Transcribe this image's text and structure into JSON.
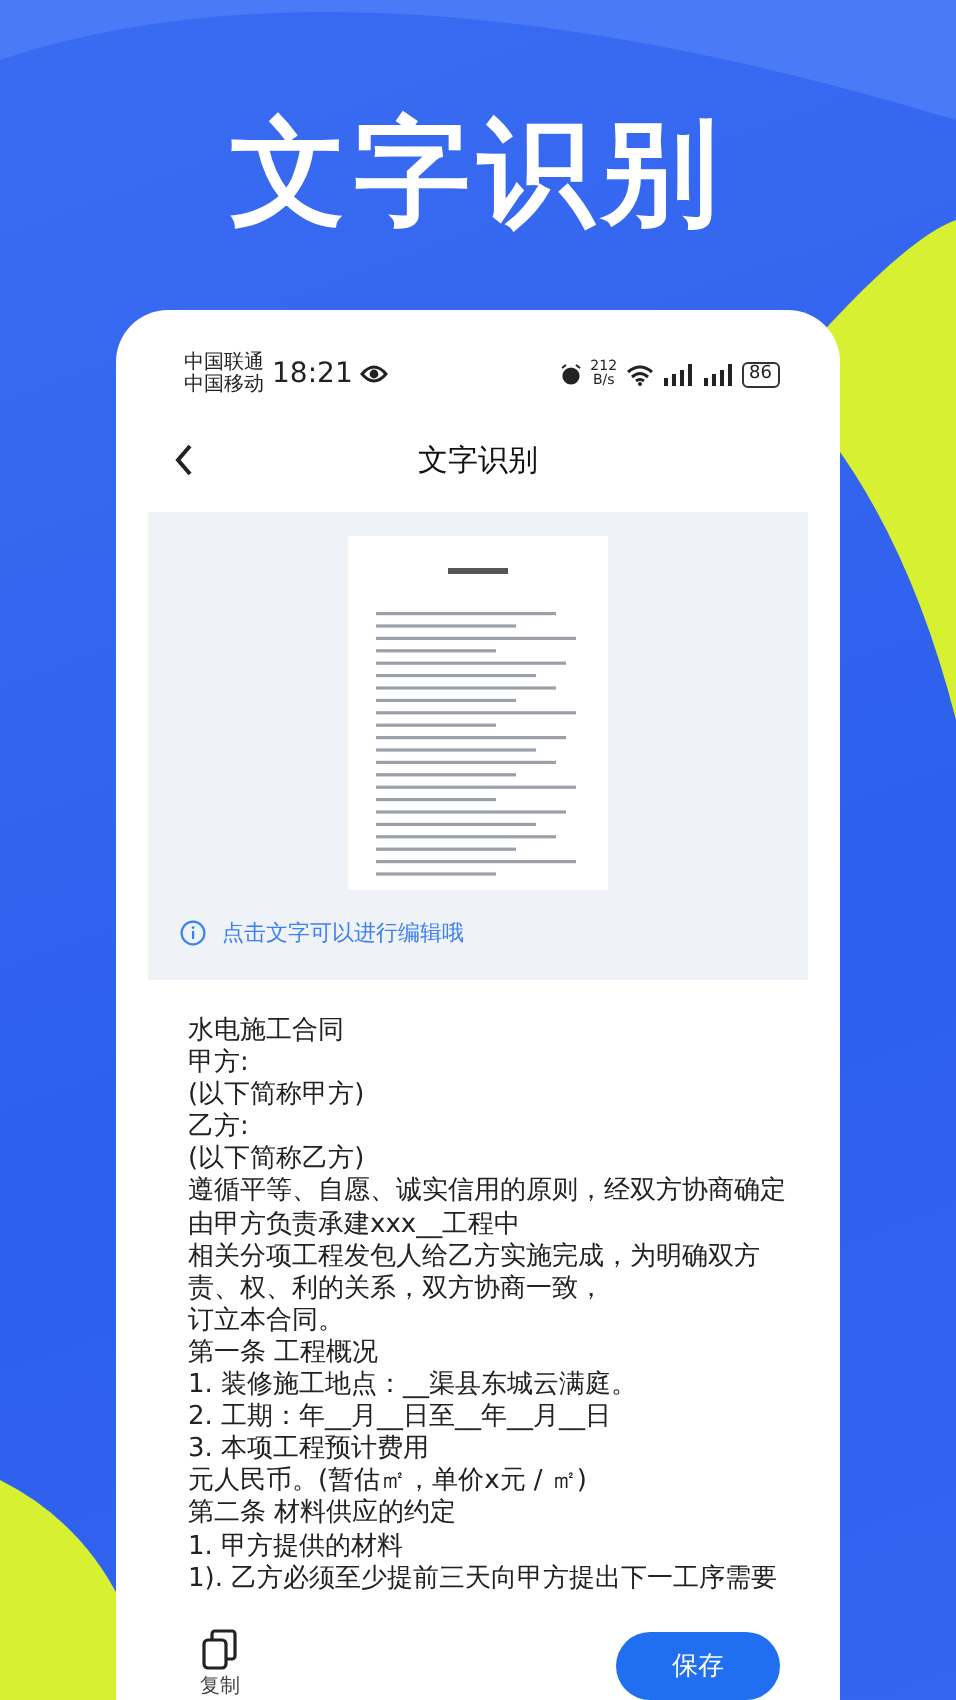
{
  "hero_title": "文字识别",
  "status_bar": {
    "carriers": [
      "中国联通",
      "中国移动"
    ],
    "time": "18:21",
    "net_speed": [
      "212",
      "B/s"
    ],
    "battery": "86"
  },
  "nav": {
    "title": "文字识别"
  },
  "preview": {
    "hint": "点击文字可以进行编辑哦"
  },
  "recognized_lines": [
    "水电施工合同",
    "甲方:",
    "(以下简称甲方)",
    "乙方:",
    "(以下简称乙方)",
    "遵循平等、自愿、诚实信用的原则，经双方协商确定",
    "由甲方负责承建xxx__工程中",
    "相关分项工程发包人给乙方实施完成，为明确双方",
    "责、权、利的关系，双方协商一致，",
    "订立本合同。",
    "第一条 工程概况",
    "1. 装修施工地点：__渠县东城云满庭。",
    "2. 工期：年__月__日至__年__月__日",
    "3. 本项工程预计费用",
    "元人民币。(暂估㎡，单价x元 / ㎡)",
    "第二条 材料供应的约定",
    "1. 甲方提供的材料",
    "1). 乙方必须至少提前三天向甲方提出下一工序需要"
  ],
  "actions": {
    "copy": "复制",
    "save": "保存"
  }
}
